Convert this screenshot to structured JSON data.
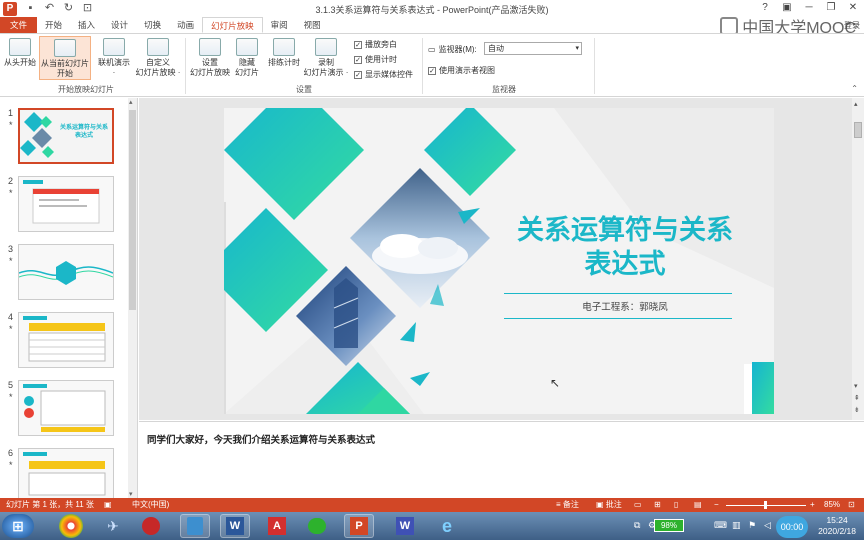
{
  "app": {
    "window_title": "3.1.3关系运算符与关系表达式 - PowerPoint(产品激活失败)",
    "brand_text": "中国大学MOOC",
    "login_label": "登录",
    "qat": [
      {
        "name": "save-icon",
        "glyph": "💾"
      },
      {
        "name": "undo-icon",
        "glyph": "↶"
      },
      {
        "name": "redo-icon",
        "glyph": "↻"
      },
      {
        "name": "slideshow-start-icon",
        "glyph": "⊡"
      }
    ],
    "window_controls": [
      "?",
      "▣",
      "─",
      "❐",
      "✕"
    ]
  },
  "tabs": [
    {
      "label": "文件",
      "kind": "file"
    },
    {
      "label": "开始"
    },
    {
      "label": "插入"
    },
    {
      "label": "设计"
    },
    {
      "label": "切换"
    },
    {
      "label": "动画"
    },
    {
      "label": "幻灯片放映",
      "active": true
    },
    {
      "label": "审阅"
    },
    {
      "label": "视图"
    }
  ],
  "ribbon": {
    "from_start": "从头开始",
    "from_current_1": "从当前幻灯片",
    "from_current_2": "开始",
    "online_1": "联机演示",
    "online_2": "·",
    "custom_1": "自定义",
    "custom_2": "幻灯片放映 ·",
    "group_start": "开始放映幻灯片",
    "setup_1": "设置",
    "setup_2": "幻灯片放映",
    "hide_1": "隐藏",
    "hide_2": "幻灯片",
    "rehearse": "排练计时",
    "record_1": "录制",
    "record_2": "幻灯片演示 ·",
    "play_narration": "播放旁白",
    "use_timings": "使用计时",
    "show_media": "显示媒体控件",
    "group_setup": "设置",
    "monitor_label": "监视器(M):",
    "monitor_value": "自动",
    "presenter_view": "使用演示者视图",
    "group_monitor": "监视器"
  },
  "thumbnails": [
    {
      "num": "1",
      "star": "*",
      "selected": true,
      "caption": "关系运算符与关系表达式"
    },
    {
      "num": "2",
      "star": "*"
    },
    {
      "num": "3",
      "star": "*"
    },
    {
      "num": "4",
      "star": "*"
    },
    {
      "num": "5",
      "star": "*"
    },
    {
      "num": "6",
      "star": "*"
    }
  ],
  "slide": {
    "title_line1": "关系运算符与关系",
    "title_line2": "表达式",
    "subtitle": "电子工程系：郭晓凤",
    "colors": {
      "teal": "#1bb7c8",
      "green": "#2fd7a2"
    }
  },
  "notes": {
    "text": "同学们大家好，今天我们介绍关系运算符与关系表达式"
  },
  "status": {
    "slide_info": "幻灯片 第 1 张，共 11 张",
    "language": "中文(中国)",
    "notes_btn": "≡ 备注",
    "comments_btn": "▣ 批注",
    "zoom": "85%"
  },
  "taskbar": {
    "apps": [
      {
        "name": "start-orb-icon",
        "label": "⊞",
        "color": "#3a7bd5"
      },
      {
        "name": "chrome-icon",
        "label": "◉",
        "color": "#e94235"
      },
      {
        "name": "bird-app-icon",
        "label": "✈",
        "color": "#4a8fd9"
      },
      {
        "name": "red-app-icon",
        "label": "●",
        "color": "#c62828"
      },
      {
        "name": "id-app-icon",
        "label": "▣",
        "color": "#3d8fcf"
      },
      {
        "name": "word-icon",
        "label": "W",
        "color": "#2b579a"
      },
      {
        "name": "acrobat-icon",
        "label": "A",
        "color": "#d32f2f"
      },
      {
        "name": "wechat-icon",
        "label": "✉",
        "color": "#2db22d"
      },
      {
        "name": "powerpoint-icon",
        "label": "P",
        "color": "#d24726"
      },
      {
        "name": "vs-app-icon",
        "label": "W",
        "color": "#3f51b5"
      },
      {
        "name": "ie-icon",
        "label": "e",
        "color": "#1e88e5"
      }
    ],
    "battery": "98%",
    "time": "15:24",
    "date": "2020/2/18",
    "rec": "00:00"
  }
}
